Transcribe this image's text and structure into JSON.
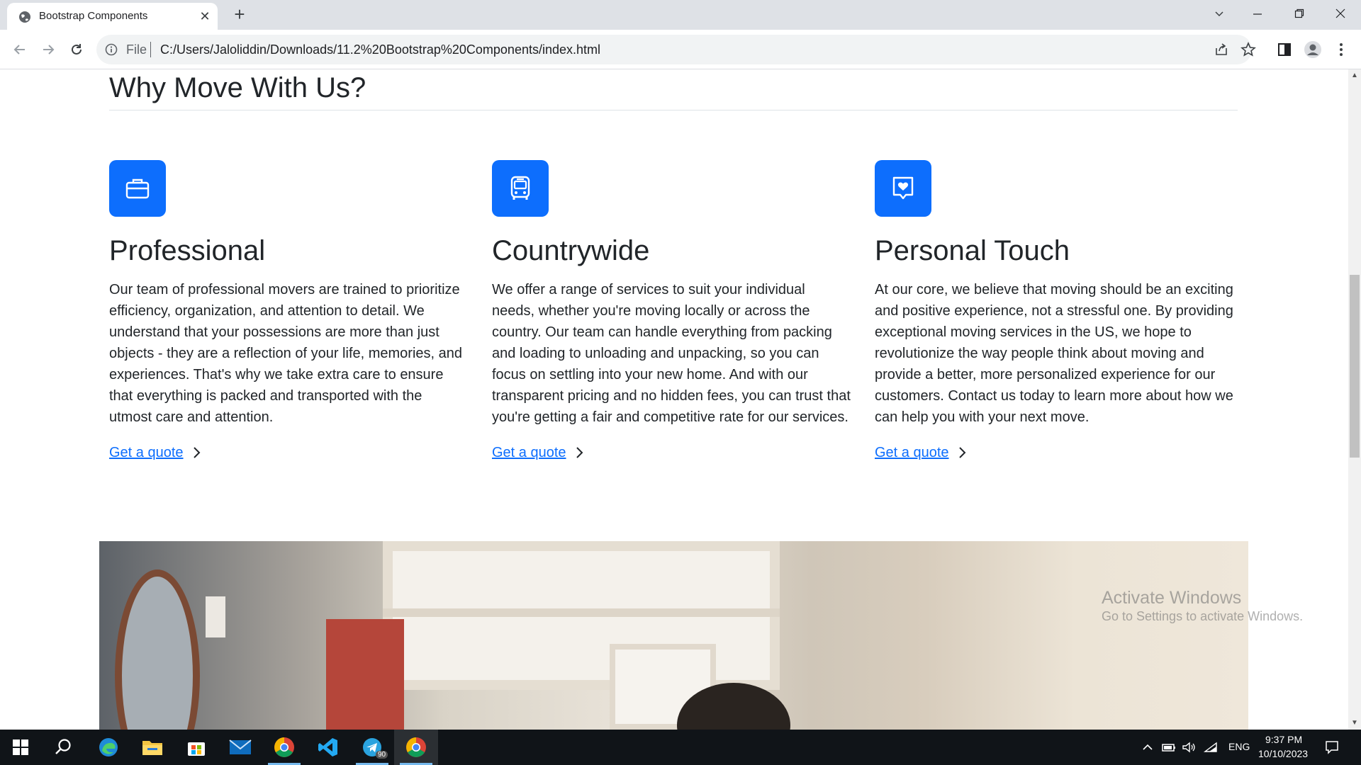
{
  "browser": {
    "tab_title": "Bootstrap Components",
    "scheme_label": "File",
    "url": "C:/Users/Jaloliddin/Downloads/11.2%20Bootstrap%20Components/index.html"
  },
  "page": {
    "section_title": "Why Move With Us?",
    "features": [
      {
        "icon": "briefcase-icon",
        "title": "Professional",
        "text": "Our team of professional movers are trained to prioritize efficiency, organization, and attention to detail. We understand that your possessions are more than just objects - they are a reflection of your life, memories, and experiences. That's why we take extra care to ensure that everything is packed and transported with the utmost care and attention.",
        "link": "Get a quote"
      },
      {
        "icon": "bus-icon",
        "title": "Countrywide",
        "text": "We offer a range of services to suit your individual needs, whether you're moving locally or across the country. Our team can handle everything from packing and loading to unloading and unpacking, so you can focus on settling into your new home. And with our transparent pricing and no hidden fees, you can trust that you're getting a fair and competitive rate for our services.",
        "link": "Get a quote"
      },
      {
        "icon": "chat-heart-icon",
        "title": "Personal Touch",
        "text": "At our core, we believe that moving should be an exciting and positive experience, not a stressful one. By providing exceptional moving services in the US, we hope to revolutionize the way people think about moving and provide a better, more personalized experience for our customers. Contact us today to learn more about how we can help you with your next move.",
        "link": "Get a quote"
      }
    ],
    "accent_color": "#0d6efd"
  },
  "watermark": {
    "line1": "Activate Windows",
    "line2": "Go to Settings to activate Windows."
  },
  "taskbar": {
    "language": "ENG",
    "time": "9:37 PM",
    "date": "10/10/2023",
    "telegram_badge": "90"
  }
}
